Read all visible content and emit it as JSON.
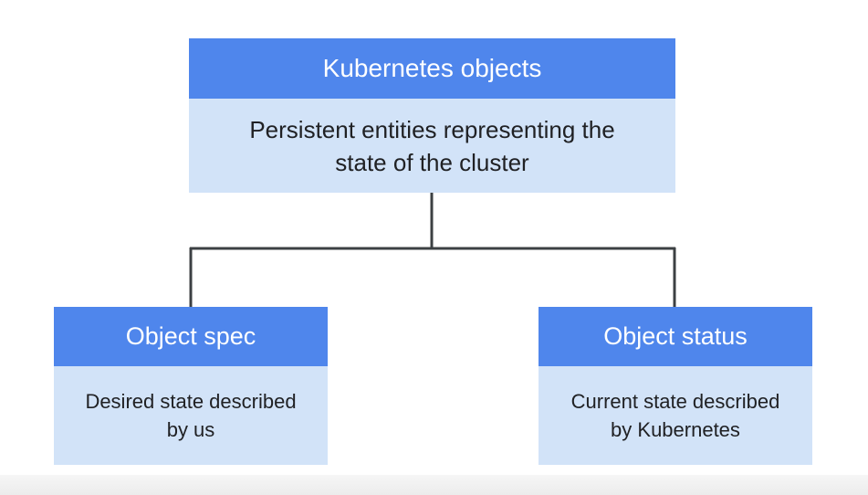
{
  "diagram": {
    "root": {
      "title": "Kubernetes objects",
      "description": "Persistent entities representing the\nstate of the cluster"
    },
    "children": [
      {
        "title": "Object spec",
        "description": "Desired state described\nby us"
      },
      {
        "title": "Object status",
        "description": "Current state described\nby Kubernetes"
      }
    ]
  },
  "colors": {
    "header": "#4f86ec",
    "body": "#d2e3f8",
    "connector": "#3c4043"
  }
}
